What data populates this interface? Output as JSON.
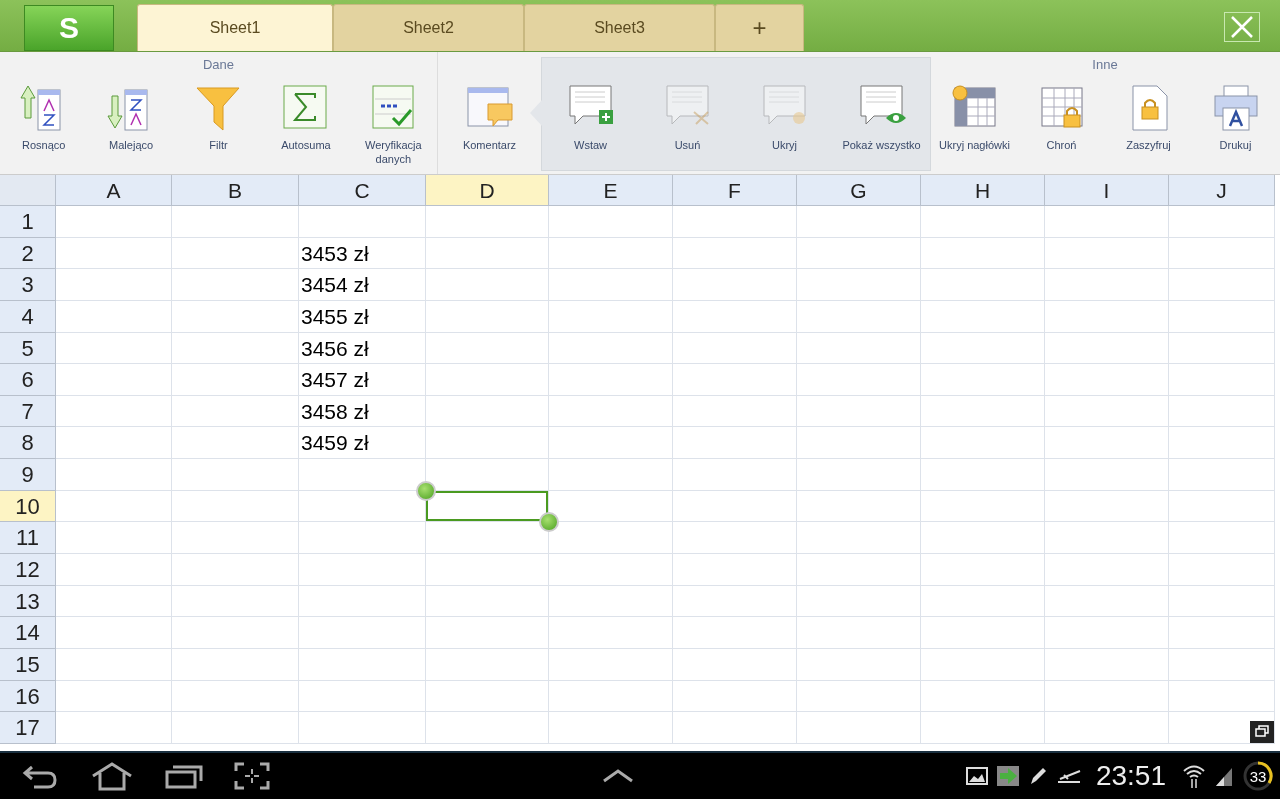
{
  "app_button": {
    "label": "S"
  },
  "sheet_tabs": [
    {
      "label": "Sheet1",
      "selected": true
    },
    {
      "label": "Sheet2",
      "selected": false
    },
    {
      "label": "Sheet3",
      "selected": false
    }
  ],
  "add_tab": {
    "label": "+"
  },
  "data_group": {
    "title": "Dane",
    "tools": [
      {
        "label": "Rosnąco"
      },
      {
        "label": "Malejąco"
      },
      {
        "label": "Filtr"
      },
      {
        "label": "Autosuma"
      },
      {
        "label": "Weryfikacja danych"
      }
    ]
  },
  "comment_tool": {
    "label": "Komentarz",
    "expanded": true
  },
  "comment_menu": [
    {
      "label": "Wstaw",
      "disabled": false
    },
    {
      "label": "Usuń",
      "disabled": true
    },
    {
      "label": "Ukryj",
      "disabled": true
    },
    {
      "label": "Pokaż wszystko",
      "disabled": false
    }
  ],
  "other_group": {
    "title": "Inne",
    "tools": [
      {
        "label": "Ukryj nagłówki"
      },
      {
        "label": "Chroń"
      },
      {
        "label": "Zaszyfruj"
      },
      {
        "label": "Drukuj"
      }
    ]
  },
  "sheet": {
    "columns": [
      {
        "label": "A",
        "selected": false
      },
      {
        "label": "B",
        "selected": false
      },
      {
        "label": "C",
        "selected": false
      },
      {
        "label": "D",
        "selected": true
      },
      {
        "label": "E",
        "selected": false
      },
      {
        "label": "F",
        "selected": false
      },
      {
        "label": "G",
        "selected": false
      },
      {
        "label": "H",
        "selected": false
      },
      {
        "label": "I",
        "selected": false
      },
      {
        "label": "J",
        "selected": false
      }
    ],
    "rows": [
      {
        "label": "1",
        "selected": false
      },
      {
        "label": "2",
        "selected": false,
        "column_c": "3453 zł"
      },
      {
        "label": "3",
        "selected": false,
        "column_c": "3454 zł"
      },
      {
        "label": "4",
        "selected": false,
        "column_c": "3455 zł"
      },
      {
        "label": "5",
        "selected": false,
        "column_c": "3456 zł"
      },
      {
        "label": "6",
        "selected": false,
        "column_c": "3457 zł"
      },
      {
        "label": "7",
        "selected": false,
        "column_c": "3458 zł"
      },
      {
        "label": "8",
        "selected": false,
        "column_c": "3459 zł"
      },
      {
        "label": "9",
        "selected": false
      },
      {
        "label": "10",
        "selected": true
      },
      {
        "label": "11",
        "selected": false
      },
      {
        "label": "12",
        "selected": false
      },
      {
        "label": "13",
        "selected": false
      },
      {
        "label": "14",
        "selected": false
      },
      {
        "label": "15",
        "selected": false
      },
      {
        "label": "16",
        "selected": false
      },
      {
        "label": "17",
        "selected": false
      }
    ]
  },
  "status_bar": {
    "time": "23:51",
    "battery": "33"
  }
}
